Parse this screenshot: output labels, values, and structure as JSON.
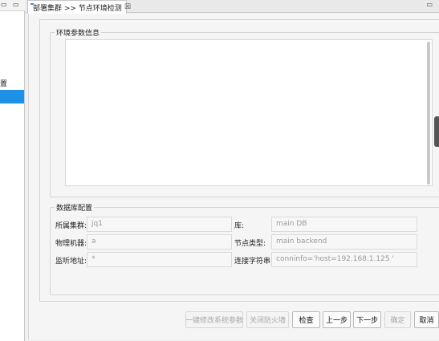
{
  "left_pane": {
    "label": "置"
  },
  "tab": {
    "title": "部署集群 >> 节点环境检测",
    "close": "☒"
  },
  "window": {
    "min": "▭",
    "max": "▭"
  },
  "env_group": {
    "title": "环境参数信息"
  },
  "db_group": {
    "title": "数据库配置",
    "fields": {
      "cluster": {
        "label": "所属集群:",
        "value": "jq1"
      },
      "library": {
        "label": "库:",
        "value": "main DB"
      },
      "machine": {
        "label": "物理机器:",
        "value": "a"
      },
      "node_type": {
        "label": "节点类型:",
        "value": "main backend"
      },
      "listen": {
        "label": "监听地址:",
        "value": "*"
      },
      "conn": {
        "label": "连接字符串:",
        "value": "conninfo='host=192.168.1.125 '"
      }
    }
  },
  "buttons": {
    "modify_params": "一键修改系统参数",
    "close_firewall": "关闭防火墙",
    "check": "检查",
    "prev": "上一步",
    "next": "下一步",
    "confirm": "确定",
    "cancel": "取消"
  }
}
